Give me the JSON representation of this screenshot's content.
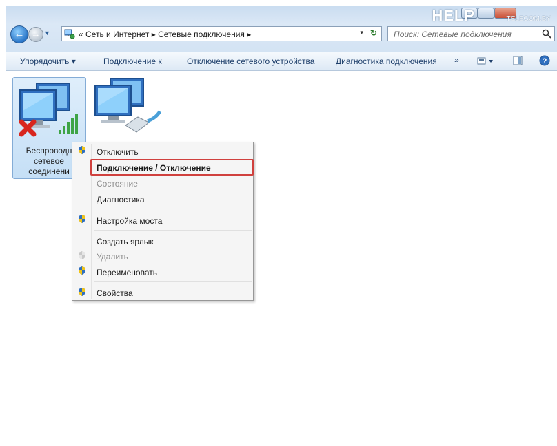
{
  "watermark": {
    "logo": "HELP",
    "sub": "TELECOM.BY"
  },
  "address_bar": {
    "path": "« Сеть и Интернет ▸ Сетевые подключения ▸",
    "dropdown": "▾",
    "refresh": "↻"
  },
  "search": {
    "placeholder": "Поиск: Сетевые подключения"
  },
  "toolbar": {
    "organize": "Упорядочить ▾",
    "connect_to": "Подключение к",
    "disable_device": "Отключение сетевого устройства",
    "diagnose": "Диагностика подключения",
    "more": "»"
  },
  "connections": [
    {
      "label": "Беспроводн сетевое соединени",
      "status": "disconnected"
    },
    {
      "label": "",
      "status": "lan"
    }
  ],
  "context_menu": {
    "items": [
      {
        "label": "Отключить",
        "icon": "shield-icon",
        "disabled": false
      },
      {
        "label": "Подключение / Отключение",
        "icon": "",
        "disabled": false,
        "bold": true
      },
      {
        "label": "Состояние",
        "icon": "",
        "disabled": true
      },
      {
        "label": "Диагностика",
        "icon": "",
        "disabled": false
      },
      {
        "label": "Настройка моста",
        "icon": "shield-icon",
        "disabled": false
      },
      {
        "label": "Создать ярлык",
        "icon": "",
        "disabled": false
      },
      {
        "label": "Удалить",
        "icon": "shield-icon",
        "disabled": true
      },
      {
        "label": "Переименовать",
        "icon": "shield-icon",
        "disabled": false
      },
      {
        "label": "Свойства",
        "icon": "shield-icon",
        "disabled": false
      }
    ]
  },
  "colors": {
    "accent": "#2a76c8",
    "highlight_border": "#d0413e"
  }
}
